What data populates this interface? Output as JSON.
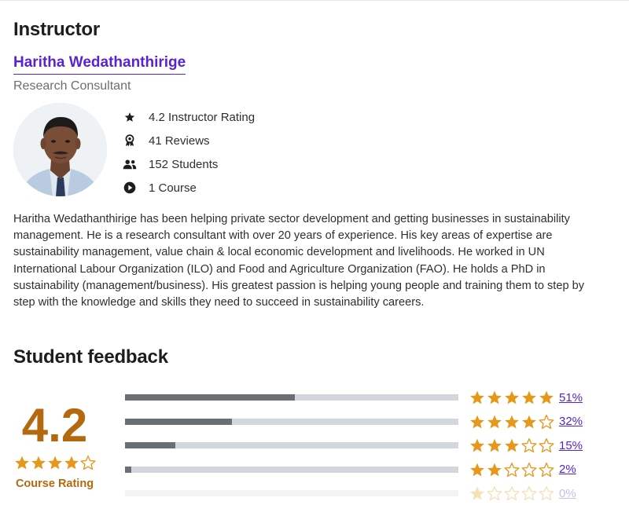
{
  "instructor": {
    "heading": "Instructor",
    "name": "Haritha Wedathanthirige",
    "job_title": "Research Consultant",
    "stats": [
      {
        "icon": "star-icon",
        "text": "4.2 Instructor Rating"
      },
      {
        "icon": "award-icon",
        "text": "41 Reviews"
      },
      {
        "icon": "people-icon",
        "text": "152 Students"
      },
      {
        "icon": "play-icon",
        "text": "1 Course"
      }
    ],
    "bio": "Haritha Wedathanthirige has been helping private sector development and getting businesses in sustainability management. He is a research consultant with over 20 years of experience. His key areas of expertise are sustainability management, value chain & local economic development and livelihoods. He worked in UN International Labour Organization (ILO) and Food and Agriculture Organization (FAO). He holds a PhD in sustainability (management/business). His greatest passion is helping young people and training them to step by step with the knowledge and skills they need to succeed in sustainability careers."
  },
  "feedback": {
    "heading": "Student feedback",
    "rating": "4.2",
    "rating_value": 4.2,
    "rating_label": "Course Rating",
    "distribution": [
      {
        "stars": 5,
        "percent": 51,
        "label": "51%"
      },
      {
        "stars": 4,
        "percent": 32,
        "label": "32%"
      },
      {
        "stars": 3,
        "percent": 15,
        "label": "15%"
      },
      {
        "stars": 2,
        "percent": 2,
        "label": "2%"
      },
      {
        "stars": 1,
        "percent": 0,
        "label": "0%"
      }
    ]
  },
  "colors": {
    "link": "#5624d0",
    "star": "#e59819",
    "rating": "#b4690e",
    "bar_fill": "#6a6f73",
    "bar_track": "#d1d7dc"
  }
}
